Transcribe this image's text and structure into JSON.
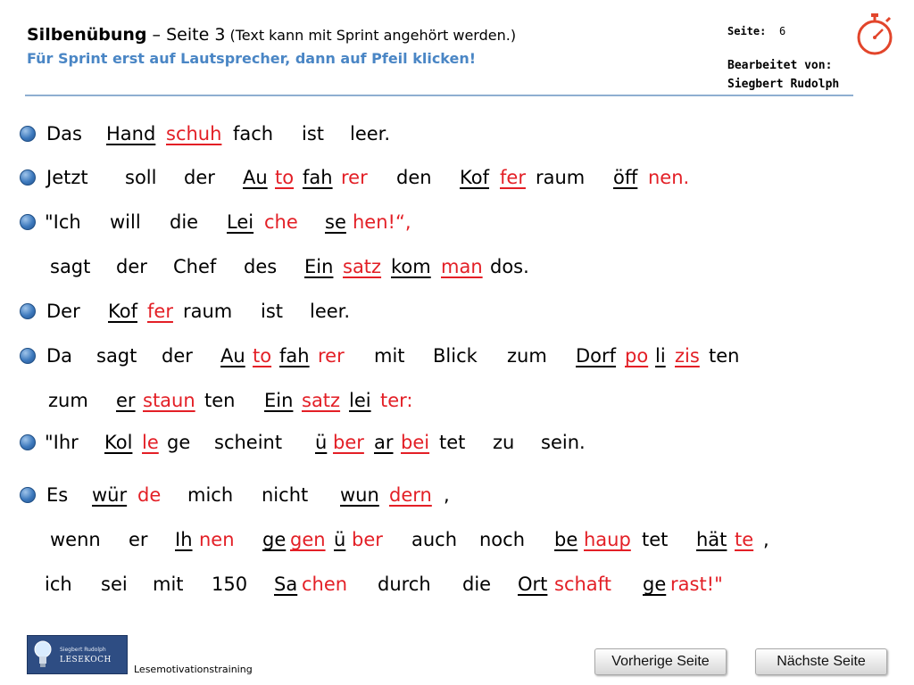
{
  "header": {
    "title_bold": "Silbenübung",
    "title_sep": " – ",
    "title_rest": "Seite 3",
    "title_note": " (Text kann mit Sprint angehört werden.)",
    "subtitle": "Für Sprint erst auf Lautsprecher, dann auf Pfeil klicken!",
    "page_label": "Seite:",
    "page_number": "6",
    "editor_label": "Bearbeitet von:",
    "editor_name": "Siegbert Rudolph"
  },
  "colors": {
    "syllable_red": "#e31f26",
    "header_blue": "#4a86c5",
    "bullet_blue": "#3d79bd"
  },
  "icons": {
    "timer": "stopwatch-icon",
    "bullet": "sphere-bullet-icon"
  },
  "lines": [
    {
      "bullet": true,
      "words": [
        {
          "t": "Das",
          "u": false,
          "r": false
        },
        {
          "t": "Hand",
          "u": true,
          "r": false
        },
        {
          "t": "schuh",
          "u": true,
          "r": true
        },
        {
          "t": "fach",
          "u": false,
          "r": false
        },
        {
          "t": "ist",
          "u": false,
          "r": false
        },
        {
          "t": "leer.",
          "u": false,
          "r": false
        }
      ]
    },
    {
      "bullet": true,
      "words": [
        {
          "t": "Jetzt",
          "u": false,
          "r": false
        },
        {
          "t": "soll",
          "u": false,
          "r": false
        },
        {
          "t": "der",
          "u": false,
          "r": false
        },
        {
          "t": "Au",
          "u": true,
          "r": false
        },
        {
          "t": "to",
          "u": true,
          "r": true
        },
        {
          "t": "fah",
          "u": true,
          "r": false
        },
        {
          "t": "rer",
          "u": false,
          "r": true
        },
        {
          "t": "den",
          "u": false,
          "r": false
        },
        {
          "t": "Kof",
          "u": true,
          "r": false
        },
        {
          "t": "fer",
          "u": true,
          "r": true
        },
        {
          "t": "raum",
          "u": false,
          "r": false
        },
        {
          "t": "öff",
          "u": true,
          "r": false
        },
        {
          "t": "nen.",
          "u": false,
          "r": true
        }
      ]
    },
    {
      "bullet": true,
      "words": [
        {
          "t": "\"Ich",
          "u": false,
          "r": false
        },
        {
          "t": "will",
          "u": false,
          "r": false
        },
        {
          "t": "die",
          "u": false,
          "r": false
        },
        {
          "t": "Lei",
          "u": true,
          "r": false
        },
        {
          "t": "che",
          "u": false,
          "r": true
        },
        {
          "t": "se",
          "u": true,
          "r": false
        },
        {
          "t": "hen!“,",
          "u": false,
          "r": true
        }
      ]
    },
    {
      "bullet": false,
      "words": [
        {
          "t": "sagt",
          "u": false,
          "r": false
        },
        {
          "t": "der",
          "u": false,
          "r": false
        },
        {
          "t": "Chef",
          "u": false,
          "r": false
        },
        {
          "t": "des",
          "u": false,
          "r": false
        },
        {
          "t": "Ein",
          "u": true,
          "r": false
        },
        {
          "t": "satz",
          "u": true,
          "r": true
        },
        {
          "t": "kom",
          "u": true,
          "r": false
        },
        {
          "t": "man",
          "u": true,
          "r": true
        },
        {
          "t": "dos.",
          "u": false,
          "r": false
        }
      ]
    },
    {
      "bullet": true,
      "words": [
        {
          "t": "Der",
          "u": false,
          "r": false
        },
        {
          "t": "Kof",
          "u": true,
          "r": false
        },
        {
          "t": "fer",
          "u": true,
          "r": true
        },
        {
          "t": "raum",
          "u": false,
          "r": false
        },
        {
          "t": "ist",
          "u": false,
          "r": false
        },
        {
          "t": "leer.",
          "u": false,
          "r": false
        }
      ]
    },
    {
      "bullet": true,
      "words": [
        {
          "t": "Da",
          "u": false,
          "r": false
        },
        {
          "t": "sagt",
          "u": false,
          "r": false
        },
        {
          "t": "der",
          "u": false,
          "r": false
        },
        {
          "t": "Au",
          "u": true,
          "r": false
        },
        {
          "t": "to",
          "u": true,
          "r": true
        },
        {
          "t": "fah",
          "u": true,
          "r": false
        },
        {
          "t": "rer",
          "u": false,
          "r": true
        },
        {
          "t": "mit",
          "u": false,
          "r": false
        },
        {
          "t": "Blick",
          "u": false,
          "r": false
        },
        {
          "t": "zum",
          "u": false,
          "r": false
        },
        {
          "t": "Dorf",
          "u": true,
          "r": false
        },
        {
          "t": "po",
          "u": true,
          "r": true
        },
        {
          "t": "li",
          "u": true,
          "r": false
        },
        {
          "t": "zis",
          "u": true,
          "r": true
        },
        {
          "t": "ten",
          "u": false,
          "r": false
        }
      ]
    },
    {
      "bullet": false,
      "words": [
        {
          "t": "zum",
          "u": false,
          "r": false
        },
        {
          "t": "er",
          "u": true,
          "r": false
        },
        {
          "t": "staun",
          "u": true,
          "r": true
        },
        {
          "t": "ten",
          "u": false,
          "r": false
        },
        {
          "t": "Ein",
          "u": true,
          "r": false
        },
        {
          "t": "satz",
          "u": true,
          "r": true
        },
        {
          "t": "lei",
          "u": true,
          "r": false
        },
        {
          "t": "ter:",
          "u": false,
          "r": true
        }
      ]
    },
    {
      "bullet": true,
      "words": [
        {
          "t": "\"Ihr",
          "u": false,
          "r": false
        },
        {
          "t": "Kol",
          "u": true,
          "r": false
        },
        {
          "t": "le",
          "u": true,
          "r": true
        },
        {
          "t": "ge",
          "u": false,
          "r": false
        },
        {
          "t": "scheint",
          "u": false,
          "r": false
        },
        {
          "t": "ü",
          "u": true,
          "r": false
        },
        {
          "t": "ber",
          "u": true,
          "r": true
        },
        {
          "t": "ar",
          "u": true,
          "r": false
        },
        {
          "t": "bei",
          "u": true,
          "r": true
        },
        {
          "t": "tet",
          "u": false,
          "r": false
        },
        {
          "t": "zu",
          "u": false,
          "r": false
        },
        {
          "t": "sein.",
          "u": false,
          "r": false
        }
      ]
    },
    {
      "bullet": true,
      "words": [
        {
          "t": "Es",
          "u": false,
          "r": false
        },
        {
          "t": "wür",
          "u": true,
          "r": false
        },
        {
          "t": "de",
          "u": false,
          "r": true
        },
        {
          "t": "mich",
          "u": false,
          "r": false
        },
        {
          "t": "nicht",
          "u": false,
          "r": false
        },
        {
          "t": "wun",
          "u": true,
          "r": false
        },
        {
          "t": "dern",
          "u": true,
          "r": true
        },
        {
          "t": ",",
          "u": false,
          "r": false
        }
      ]
    },
    {
      "bullet": false,
      "words": [
        {
          "t": "wenn",
          "u": false,
          "r": false
        },
        {
          "t": "er",
          "u": false,
          "r": false
        },
        {
          "t": "Ih",
          "u": true,
          "r": false
        },
        {
          "t": "nen",
          "u": false,
          "r": true
        },
        {
          "t": "ge",
          "u": true,
          "r": false
        },
        {
          "t": "gen",
          "u": true,
          "r": true
        },
        {
          "t": "ü",
          "u": true,
          "r": false
        },
        {
          "t": "ber",
          "u": false,
          "r": true
        },
        {
          "t": "auch",
          "u": false,
          "r": false
        },
        {
          "t": "noch",
          "u": false,
          "r": false
        },
        {
          "t": "be",
          "u": true,
          "r": false
        },
        {
          "t": "haup",
          "u": true,
          "r": true
        },
        {
          "t": "tet",
          "u": false,
          "r": false
        },
        {
          "t": "hät",
          "u": true,
          "r": false
        },
        {
          "t": "te",
          "u": true,
          "r": true
        },
        {
          "t": ",",
          "u": false,
          "r": false
        }
      ]
    },
    {
      "bullet": false,
      "words": [
        {
          "t": "ich",
          "u": false,
          "r": false
        },
        {
          "t": "sei",
          "u": false,
          "r": false
        },
        {
          "t": "mit",
          "u": false,
          "r": false
        },
        {
          "t": "150",
          "u": false,
          "r": false
        },
        {
          "t": "Sa",
          "u": true,
          "r": false
        },
        {
          "t": "chen",
          "u": false,
          "r": true
        },
        {
          "t": "durch",
          "u": false,
          "r": false
        },
        {
          "t": "die",
          "u": false,
          "r": false
        },
        {
          "t": "Ort",
          "u": true,
          "r": false
        },
        {
          "t": "schaft",
          "u": false,
          "r": true
        },
        {
          "t": "ge",
          "u": true,
          "r": false
        },
        {
          "t": "rast!\"",
          "u": false,
          "r": true
        }
      ]
    }
  ],
  "footer": {
    "logo_line1": "Siegbert Rudolph",
    "logo_line2": "LESEKOCH",
    "label": "Lesemotivationstraining",
    "prev_button": "Vorherige Seite",
    "next_button": "Nächste Seite"
  }
}
